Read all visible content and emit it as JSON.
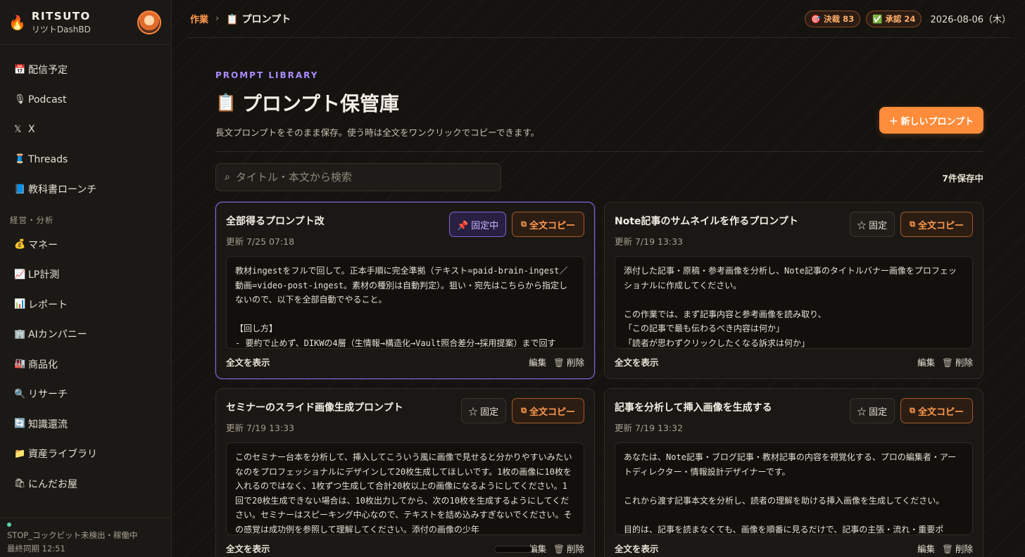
{
  "brand": {
    "name": "RITSUTO",
    "sub": "リツトDashBD"
  },
  "sidebar": {
    "items": [
      {
        "icon": "📅",
        "label": "配信予定"
      },
      {
        "icon": "🎙",
        "label": "Podcast"
      },
      {
        "icon": "𝕏",
        "label": "X"
      },
      {
        "icon": "🧵",
        "label": "Threads"
      },
      {
        "icon": "📘",
        "label": "教科書ローンチ"
      }
    ],
    "section": "経営・分析",
    "section_items": [
      {
        "icon": "💰",
        "label": "マネー"
      },
      {
        "icon": "📈",
        "label": "LP計測"
      },
      {
        "icon": "📊",
        "label": "レポート"
      },
      {
        "icon": "🏢",
        "label": "AIカンパニー"
      },
      {
        "icon": "🏭",
        "label": "商品化"
      },
      {
        "icon": "🔍",
        "label": "リサーチ"
      },
      {
        "icon": "🔄",
        "label": "知識還流"
      },
      {
        "icon": "📁",
        "label": "資産ライブラリ"
      },
      {
        "icon": "🛍",
        "label": "にんだお屋"
      }
    ],
    "status_line": "STOP_コックピット未検出・稼働中",
    "last_sync": "最終同期 12:51"
  },
  "topbar": {
    "crumb_root": "作業",
    "crumb_sep": "›",
    "crumb_current": "📋 プロンプト",
    "pills": [
      {
        "icon": "🎯",
        "label": "決裁 83"
      },
      {
        "icon": "✅",
        "label": "承認 24"
      }
    ],
    "date": "2026-08-06（木）"
  },
  "page": {
    "eyebrow": "PROMPT LIBRARY",
    "title_icon": "📋",
    "title": "プロンプト保管庫",
    "description": "長文プロンプトをそのまま保存。使う時は全文をワンクリックでコピーできます。",
    "new_button": "＋ 新しいプロンプト",
    "search_placeholder": "タイトル・本文から検索",
    "count": "7件保存中"
  },
  "cards": [
    {
      "title": "全部得るプロンプト改",
      "date": "更新 7/25 07:18",
      "pin_label": "📌 固定中",
      "copy_label": "全文コピー",
      "body": "教材ingestをフルで回して。正本手順に完全準拠（テキスト=paid-brain-ingest／動画=video-post-ingest。素材の種別は自動判定）。狙い・宛先はこちらから指定しないので、以下を全部自動でやること。\n\n【回し方】\n- 要約で止めず、DIKWの4層（生情報→構造化→Vault照合差分→採用提案）まで回す",
      "show": "全文を表示",
      "edit": "編集",
      "delete": "削除"
    },
    {
      "title": "Note記事のサムネイルを作るプロンプト",
      "date": "更新 7/19 13:33",
      "pin_label": "☆ 固定",
      "copy_label": "全文コピー",
      "body": "添付した記事・原稿・参考画像を分析し、Note記事のタイトルバナー画像をプロフェッショナルに作成してください。\n\nこの作業では、まず記事内容と参考画像を読み取り、\n「この記事で最も伝わるべき内容は何か」\n「読者が思わずクリックしたくなる訴求は何か」",
      "show": "全文を表示",
      "edit": "編集",
      "delete": "削除"
    },
    {
      "title": "セミナーのスライド画像生成プロンプト",
      "date": "更新 7/19 13:33",
      "pin_label": "☆ 固定",
      "copy_label": "全文コピー",
      "body": "このセミナー台本を分析して、挿入してこういう風に画像で見せると分かりやすいみたいなのをプロフェッショナルにデザインして20枚生成してほしいです。1枚の画像に10枚を入れるのではなく、1枚ずつ生成して合計20枚以上の画像になるようにしてください。1回で20枚生成できない場合は、10枚出力してから、次の10枚を生成するようにしてください。セミナーはスピーキング中心なので、テキストを詰め込みすぎないでください。その感覚は成功例を参照して理解してください。添付の画像の少年",
      "show": "全文を表示",
      "edit": "編集",
      "delete": "削除"
    },
    {
      "title": "記事を分析して挿入画像を生成する",
      "date": "更新 7/19 13:32",
      "pin_label": "☆ 固定",
      "copy_label": "全文コピー",
      "body": "あなたは、Note記事・ブログ記事・教材記事の内容を視覚化する、プロの編集者・アートディレクター・情報設計デザイナーです。\n\nこれから渡す記事本文を分析し、読者の理解を助ける挿入画像を生成してください。\n\n目的は、記事を読まなくても、画像を順番に見るだけで、記事の主張・流れ・重要ポ",
      "show": "全文を表示",
      "edit": "編集",
      "delete": "削除"
    }
  ]
}
